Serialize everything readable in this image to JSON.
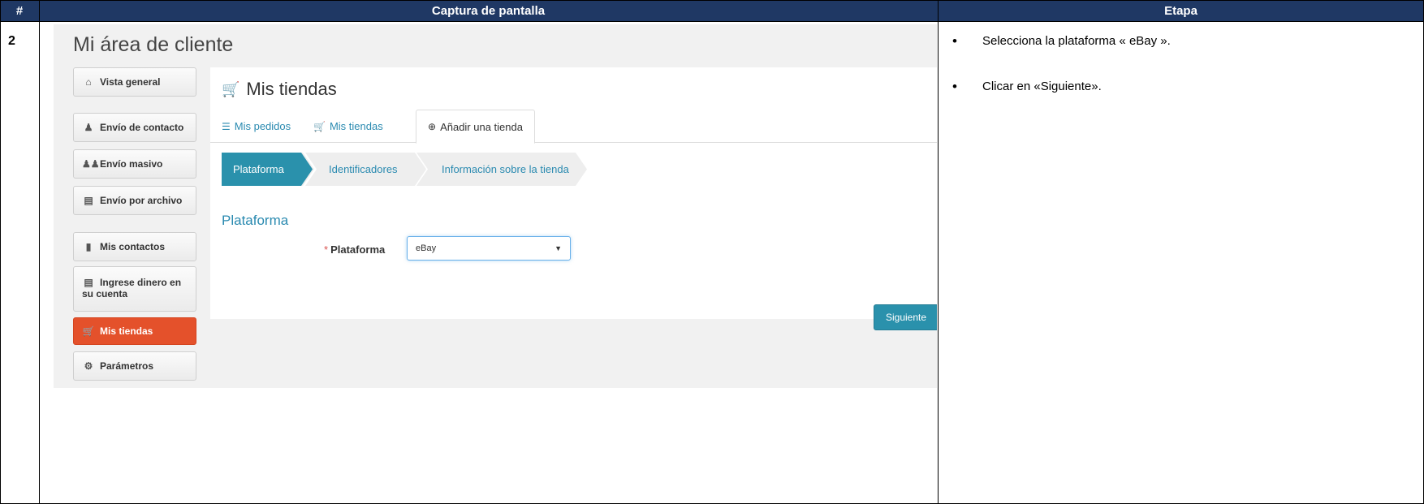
{
  "table": {
    "header_num": "#",
    "header_screenshot": "Captura de pantalla",
    "header_step": "Etapa",
    "row_num": "2"
  },
  "screenshot": {
    "page_title": "Mi área de cliente",
    "sidebar": [
      {
        "icon": "home-icon",
        "label": "Vista general"
      },
      {
        "icon": "user-icon",
        "label": "Envío de contacto"
      },
      {
        "icon": "users-icon",
        "label": "Envío masivo"
      },
      {
        "icon": "save-icon",
        "label": "Envío por archivo"
      },
      {
        "icon": "book-icon",
        "label": "Mis contactos"
      },
      {
        "icon": "credit-card-icon",
        "label_line1": "Ingrese dinero en",
        "label_line2": "su cuenta"
      },
      {
        "icon": "cart-icon",
        "label": "Mis tiendas"
      },
      {
        "icon": "cogs-icon",
        "label": "Parámetros"
      }
    ],
    "panel_title": "Mis tiendas",
    "tabs": [
      {
        "icon": "list-icon",
        "label": "Mis pedidos"
      },
      {
        "icon": "cart-icon",
        "label": "Mis tiendas"
      },
      {
        "icon": "plus-circle-icon",
        "label": "Añadir una tienda"
      }
    ],
    "wizard": [
      "Plataforma",
      "Identificadores",
      "Información sobre la tienda"
    ],
    "section_title": "Plataforma",
    "field_required_mark": "*",
    "field_label": "Plataforma",
    "select_value": "eBay",
    "next_button": "Siguiente",
    "colors": {
      "accent": "#2a91ac",
      "active_sidebar": "#e4512b",
      "header": "#1f3864"
    }
  },
  "steps": [
    "Selecciona la plataforma « eBay ».",
    "Clicar en «Siguiente»."
  ]
}
